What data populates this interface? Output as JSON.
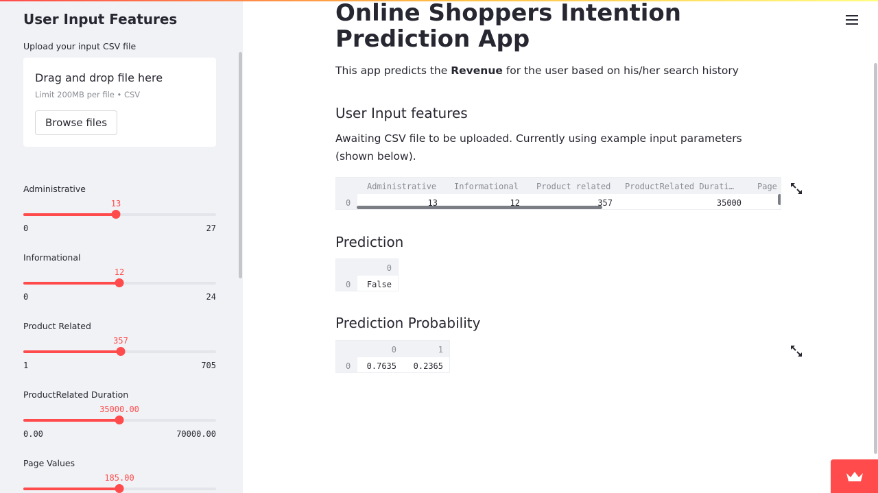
{
  "sidebar": {
    "title": "User Input Features",
    "upload": {
      "label": "Upload your input CSV file",
      "drag_text": "Drag and drop file here",
      "limit_text": "Limit 200MB per file • CSV",
      "browse_label": "Browse files"
    },
    "sliders": [
      {
        "label": "Administrative",
        "value": "13",
        "min": "0",
        "max": "27",
        "fraction": 0.4815
      },
      {
        "label": "Informational",
        "value": "12",
        "min": "0",
        "max": "24",
        "fraction": 0.5
      },
      {
        "label": "Product Related",
        "value": "357",
        "min": "1",
        "max": "705",
        "fraction": 0.5057
      },
      {
        "label": "ProductRelated Duration",
        "value": "35000.00",
        "min": "0.00",
        "max": "70000.00",
        "fraction": 0.5
      },
      {
        "label": "Page Values",
        "value": "185.00",
        "min": "",
        "max": "",
        "fraction": 0.5
      }
    ]
  },
  "main": {
    "title": "Online Shoppers Intention Prediction App",
    "intro_before": "This app predicts the ",
    "intro_bold": "Revenue",
    "intro_after": " for the user based on his/her search history",
    "input_heading": "User Input features",
    "await_text": "Awaiting CSV file to be uploaded. Currently using example input parameters (shown below).",
    "input_table": {
      "columns": [
        "Administrative",
        "Informational",
        "Product related",
        "ProductRelated Durati…",
        "Page"
      ],
      "rows": [
        {
          "index": "0",
          "values": [
            "13",
            "12",
            "357",
            "35000",
            ""
          ]
        }
      ]
    },
    "prediction_heading": "Prediction",
    "prediction_table": {
      "columns": [
        "0"
      ],
      "rows": [
        {
          "index": "0",
          "values": [
            "False"
          ]
        }
      ]
    },
    "probability_heading": "Prediction Probability",
    "probability_table": {
      "columns": [
        "0",
        "1"
      ],
      "rows": [
        {
          "index": "0",
          "values": [
            "0.7635",
            "0.2365"
          ]
        }
      ]
    }
  },
  "icons": {
    "menu": "hamburger-menu-icon",
    "expand": "fullscreen-expand-icon",
    "badge": "crown-icon"
  },
  "colors": {
    "accent": "#ff4b4b",
    "sidebar_bg": "#f0f2f6",
    "text": "#262730"
  }
}
